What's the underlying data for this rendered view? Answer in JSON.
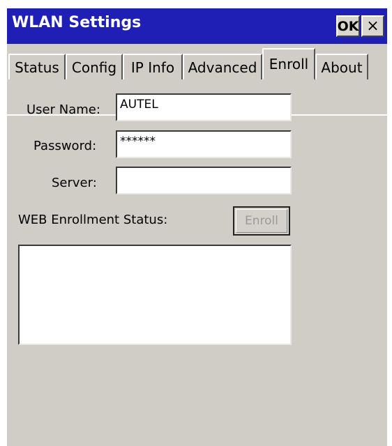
{
  "window": {
    "title": "WLAN Settings",
    "ok_label": "OK",
    "close_label": "×"
  },
  "tabs": [
    {
      "label": "Status",
      "active": false
    },
    {
      "label": "Config",
      "active": false
    },
    {
      "label": "IP Info",
      "active": false
    },
    {
      "label": "Advanced",
      "active": false
    },
    {
      "label": "Enroll",
      "active": true
    },
    {
      "label": "About",
      "active": false
    }
  ],
  "form": {
    "username_label": "User Name:",
    "username_value": "AUTEL",
    "password_label": "Password:",
    "password_value": "******",
    "server_label": "Server:",
    "server_value": "",
    "status_label": "WEB Enrollment Status:",
    "enroll_button": "Enroll",
    "status_text": ""
  },
  "colors": {
    "titlebar": "#1f1fb5",
    "background": "#cfcdc5",
    "disabled_text": "#9a9a9a"
  }
}
